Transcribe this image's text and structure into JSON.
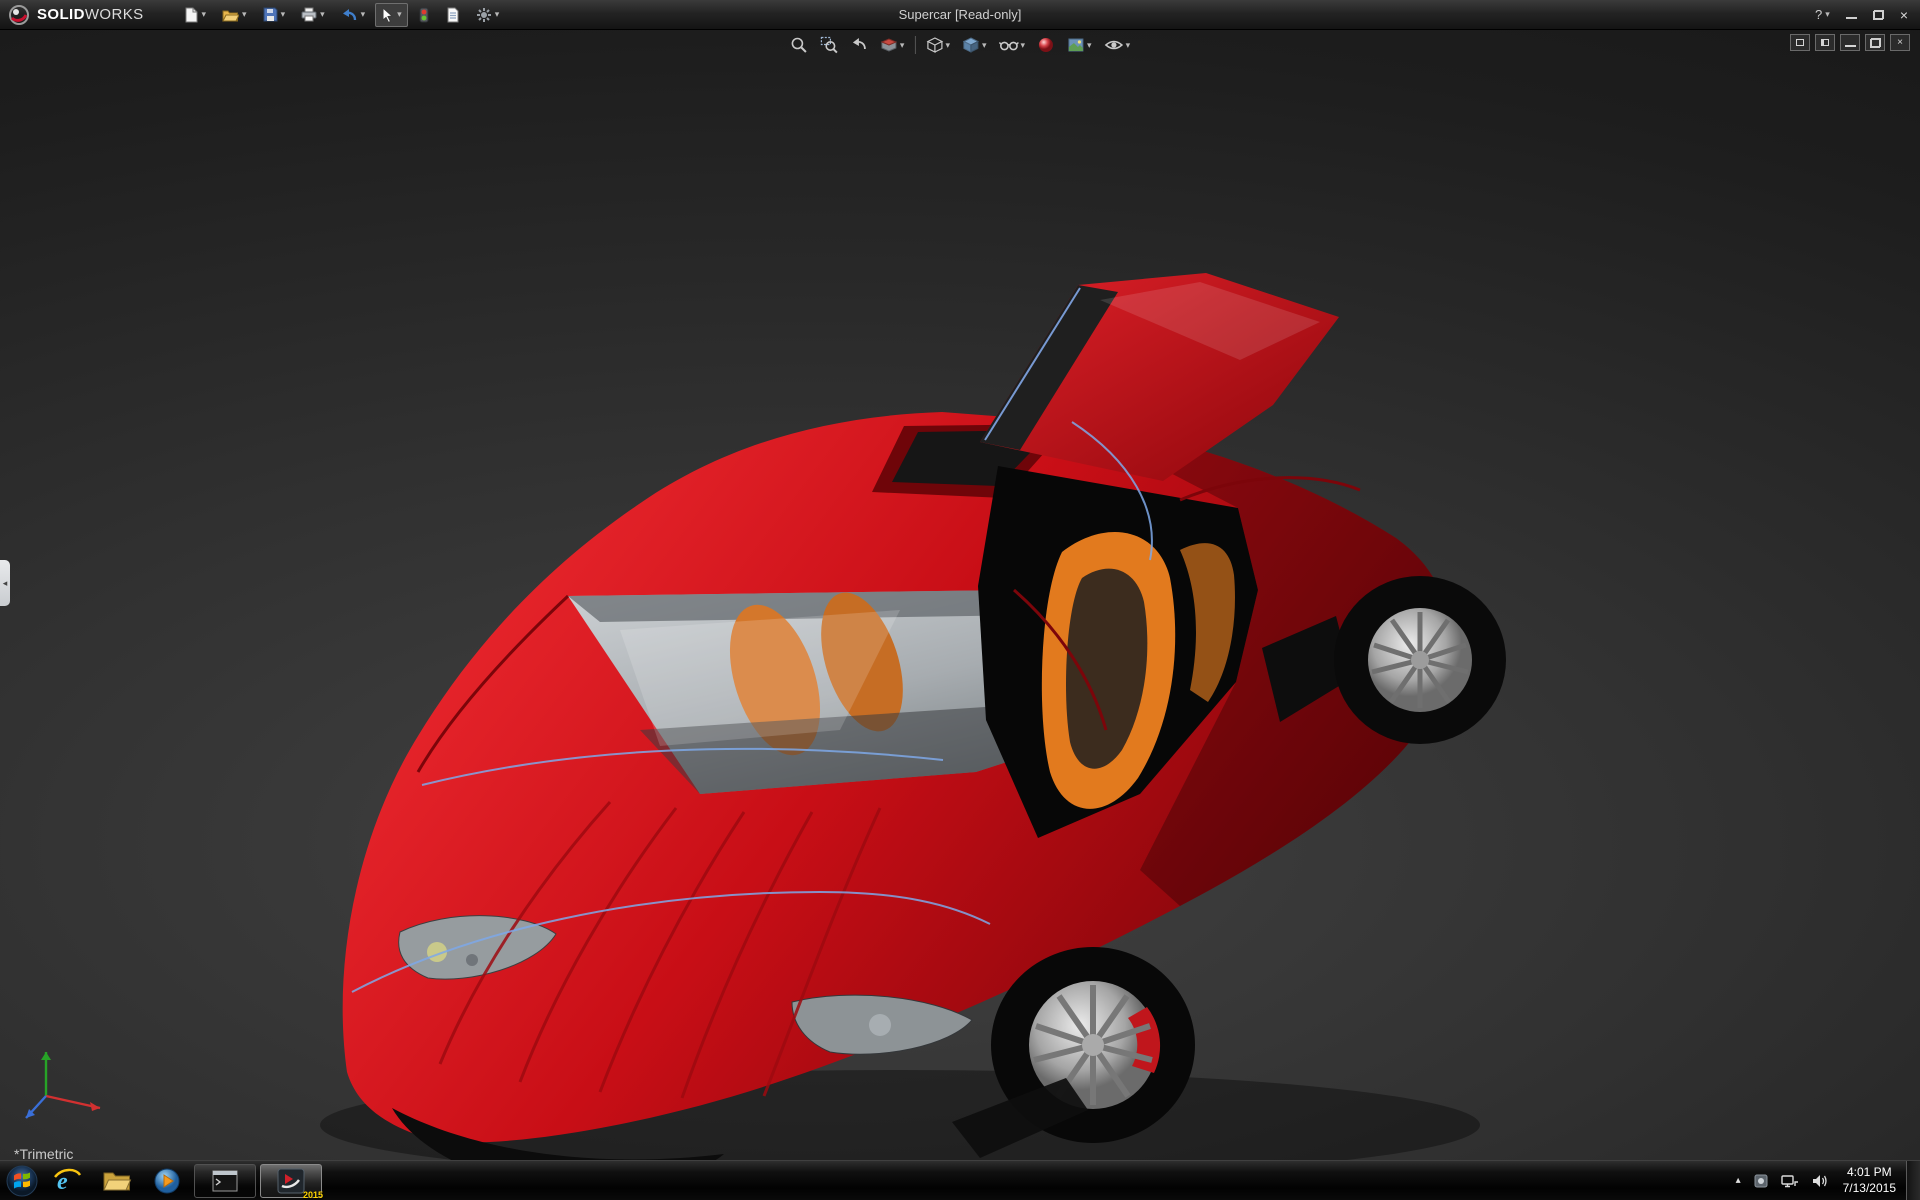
{
  "app": {
    "brand_solid": "SOLID",
    "brand_works": "WORKS",
    "document_title": "Supercar [Read-only]"
  },
  "icons": {
    "dropdown": "▾",
    "help": "?",
    "close": "×",
    "tray_show_hidden": "▴",
    "ie_glyph": "e"
  },
  "main_toolbar": {
    "items": [
      "new-document-icon",
      "open-icon",
      "save-icon",
      "print-icon",
      "undo-icon",
      "select-icon",
      "rebuild-icon",
      "file-properties-icon",
      "options-icon"
    ]
  },
  "heads_up_toolbar": {
    "items": [
      "zoom-to-fit-icon",
      "zoom-to-area-icon",
      "previous-view-icon",
      "section-view-icon",
      "view-orientation-icon",
      "display-style-icon",
      "hide-show-items-icon",
      "edit-appearance-icon",
      "apply-scene-icon",
      "view-settings-icon"
    ]
  },
  "viewport": {
    "view_label": "*Trimetric",
    "model": "red supercar with open scissor door, orange seats"
  },
  "colors": {
    "car_red": "#c00d14",
    "seat_orange": "#e27a1e",
    "edge_blue": "#7ea8e8",
    "viewport_dark": "#1d1d1d"
  },
  "taskbar": {
    "solidworks_badge": "2015",
    "clock": {
      "time": "4:01 PM",
      "date": "7/13/2015"
    },
    "items": [
      "start-button",
      "internet-explorer",
      "windows-explorer",
      "media-player",
      "app-window",
      "solidworks-2015"
    ],
    "tray_items": [
      "show-hidden-icons",
      "tray-app-icon",
      "network-icon",
      "volume-icon"
    ]
  }
}
